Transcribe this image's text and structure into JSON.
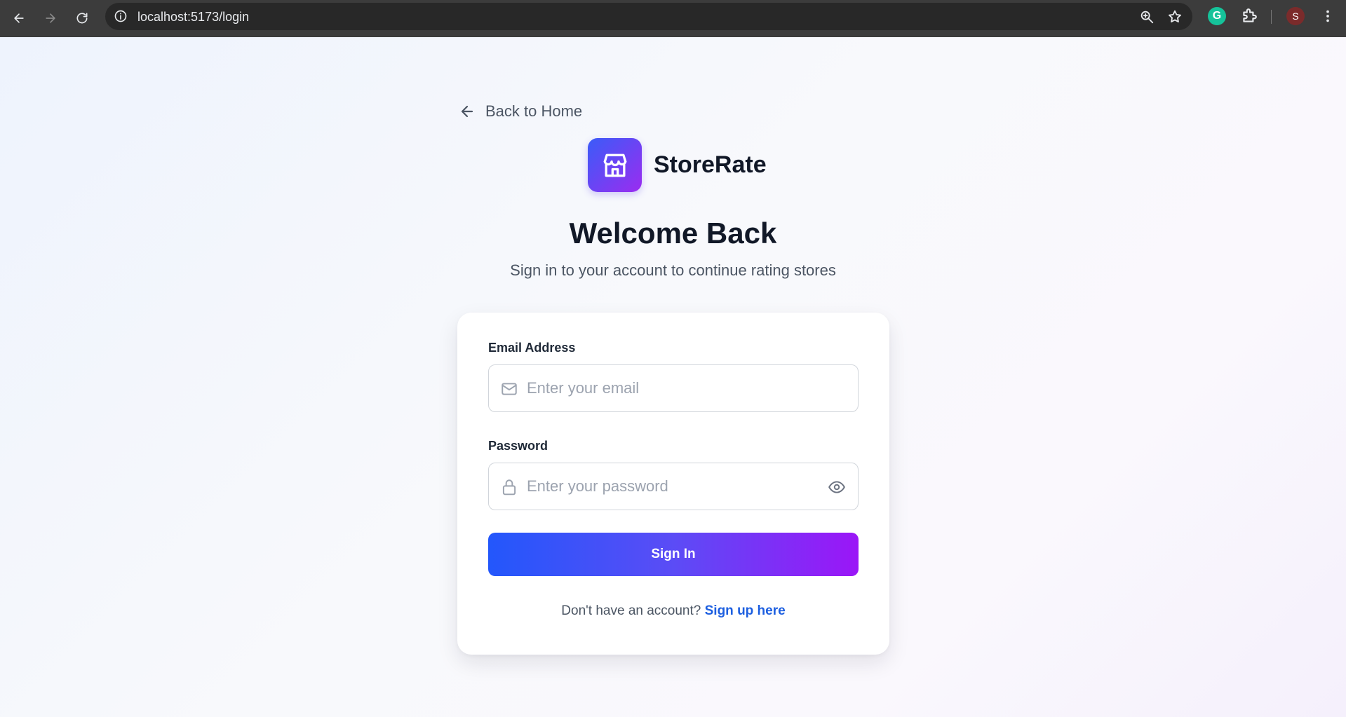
{
  "browser": {
    "url": "localhost:5173/login",
    "avatar_letter": "S",
    "grammarly_letter": "G"
  },
  "page": {
    "back_label": "Back to Home",
    "brand_name": "StoreRate",
    "title": "Welcome Back",
    "subtitle": "Sign in to your account to continue rating stores"
  },
  "form": {
    "email_label": "Email Address",
    "email_placeholder": "Enter your email",
    "password_label": "Password",
    "password_placeholder": "Enter your password",
    "submit_label": "Sign In",
    "signup_prompt": "Don't have an account?",
    "signup_link": "Sign up here"
  },
  "colors": {
    "accent_start": "#2357fb",
    "accent_end": "#9b16f7",
    "link": "#1d5fe0"
  },
  "icons": [
    "back-arrow-icon",
    "forward-arrow-icon",
    "reload-icon",
    "info-icon",
    "zoom-icon",
    "star-icon",
    "grammarly-icon",
    "extensions-icon",
    "menu-icon",
    "arrow-left-icon",
    "store-icon",
    "mail-icon",
    "lock-icon",
    "eye-icon"
  ]
}
